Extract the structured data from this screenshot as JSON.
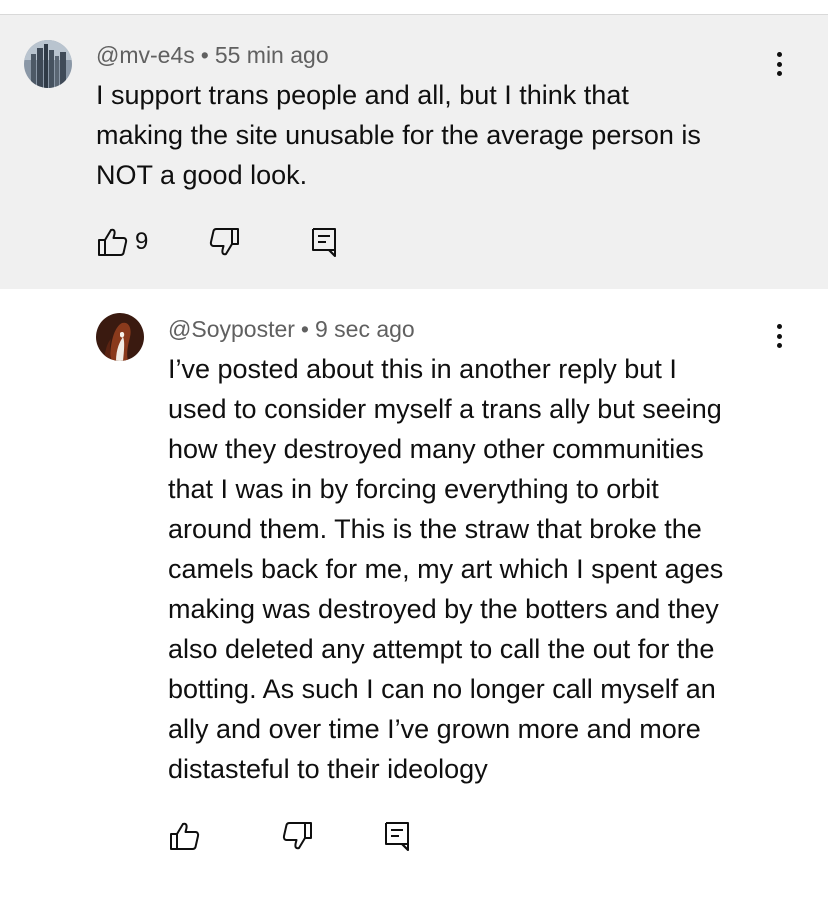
{
  "comments": [
    {
      "handle": "@mv-e4s",
      "separator": "•",
      "time": "55 min ago",
      "lines": [
        "I support trans people and all, but I think that",
        "making the site unusable for the average person is",
        "NOT a good look."
      ],
      "like_count": "9",
      "highlighted": true
    },
    {
      "handle": "@Soyposter",
      "separator": "•",
      "time": "9 sec ago",
      "lines": [
        "I’ve posted about this in another reply but I",
        "used to consider myself a trans ally but seeing",
        "how they destroyed many other communities",
        "that I was in by forcing everything to orbit",
        "around them. This is the straw that broke the",
        "camels back for me, my art which I spent ages",
        "making was destroyed by the botters and they",
        "also deleted any attempt to call the out for the",
        "botting. As such I can no longer call myself an",
        "ally and over time I’ve grown more and more",
        "distasteful to their ideology"
      ],
      "like_count": "",
      "highlighted": false
    }
  ],
  "icons": {
    "avatar_1": "city-skyline-avatar",
    "avatar_2": "portrait-avatar",
    "like": "thumbs-up-icon",
    "dislike": "thumbs-down-icon",
    "reply": "reply-comment-icon",
    "menu": "more-vert-icon"
  },
  "colors": {
    "highlight_bg": "#f0f0f0",
    "meta_text": "#606060",
    "body_text": "#0f0f0f"
  }
}
